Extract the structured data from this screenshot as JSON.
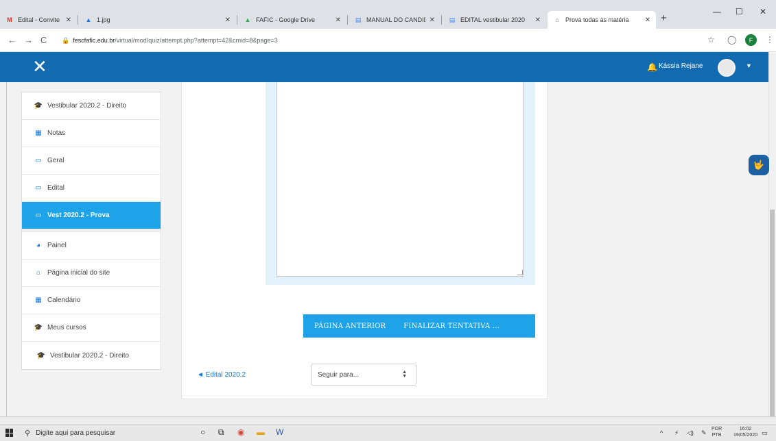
{
  "browser": {
    "tabs": [
      {
        "label": "Edital - Convite para c",
        "icon": "gmail-icon",
        "icon_char": "M",
        "icon_color": "#d93025"
      },
      {
        "label": "1.jpg",
        "icon": "drive-icon",
        "icon_char": "▲",
        "icon_color": "#1a73e8"
      },
      {
        "label": "FAFIC - Google Drive",
        "icon": "drive-icon",
        "icon_char": "▲",
        "icon_color": "#34a853"
      },
      {
        "label": "MANUAL DO CANDID",
        "icon": "docs-icon",
        "icon_char": "▤",
        "icon_color": "#4285f4"
      },
      {
        "label": "EDITAL vestibular 2020",
        "icon": "docs-icon",
        "icon_char": "▤",
        "icon_color": "#4285f4"
      },
      {
        "label": "Prova todas as matéria",
        "icon": "moodle-icon",
        "icon_char": "⌂",
        "icon_color": "#777777"
      }
    ],
    "url_host": "fescfafic.edu.br",
    "url_path": "/virtual/mod/quiz/attempt.php?attempt=42&cmid=8&page=3",
    "profile_initial": "F"
  },
  "navbar": {
    "close_glyph": "✕",
    "user_name": "Kássia Rejane"
  },
  "sidebar": {
    "items": [
      {
        "label": "Vestibular 2020.2 - Direito",
        "icon": "mortarboard-icon",
        "glyph": "🎓"
      },
      {
        "label": "Notas",
        "icon": "table-icon",
        "glyph": "▦"
      },
      {
        "label": "Geral",
        "icon": "folder-icon",
        "glyph": "▭"
      },
      {
        "label": "Edital",
        "icon": "folder-icon",
        "glyph": "▭"
      },
      {
        "label": "Vest 2020.2 - Prova",
        "icon": "folder-icon",
        "glyph": "▭"
      },
      {
        "label": "Painel",
        "icon": "dashboard-icon",
        "glyph": "◕"
      },
      {
        "label": "Página inicial do site",
        "icon": "home-icon",
        "glyph": "⌂"
      },
      {
        "label": "Calendário",
        "icon": "calendar-icon",
        "glyph": "▦"
      },
      {
        "label": "Meus cursos",
        "icon": "mortarboard-icon",
        "glyph": "🎓"
      },
      {
        "label": "Vestibular 2020.2 - Direito",
        "icon": "mortarboard-icon",
        "glyph": "🎓"
      }
    ],
    "active_index": 4
  },
  "quiz": {
    "prev_button": "PÁGINA ANTERIOR",
    "finish_button": "FINALIZAR TENTATIVA ...",
    "back_link": "◄ Edital 2020.2",
    "jump_select": "Seguir para..."
  },
  "taskbar": {
    "search_placeholder": "Digite aqui para pesquisar",
    "lang_top": "POR",
    "lang_bottom": "PTB",
    "time": "16:02",
    "date": "19/05/2020"
  },
  "colors": {
    "navbar": "#126bb0",
    "accent": "#1fa3e8",
    "link": "#1177d1"
  }
}
